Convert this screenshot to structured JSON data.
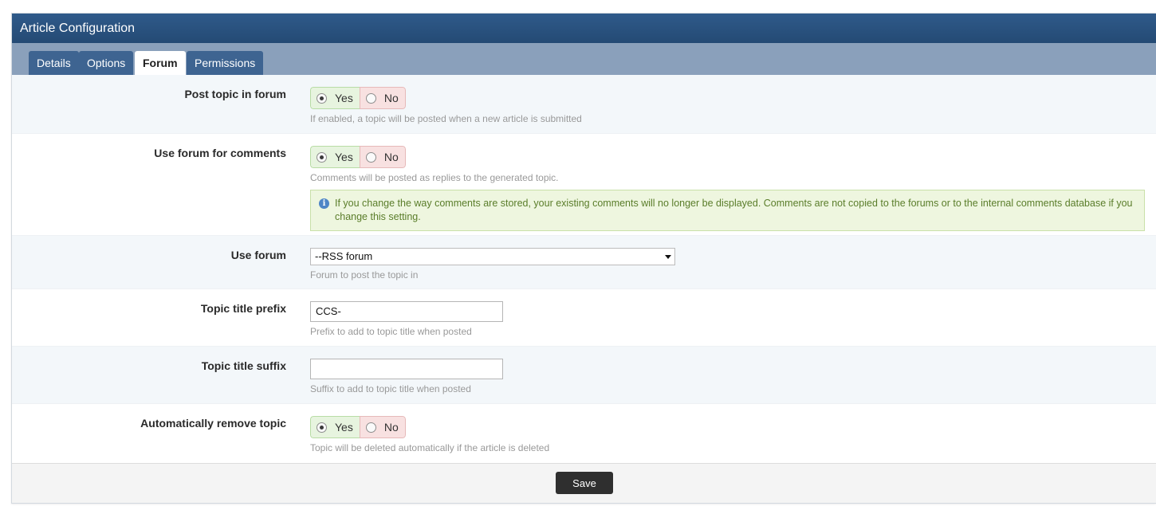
{
  "window": {
    "title": "Article Configuration"
  },
  "tabs": [
    {
      "label": "Details",
      "active": false
    },
    {
      "label": "Options",
      "active": false
    },
    {
      "label": "Forum",
      "active": true
    },
    {
      "label": "Permissions",
      "active": false
    }
  ],
  "fields": {
    "post_topic": {
      "label": "Post topic in forum",
      "selected": "Yes",
      "yes_label": "Yes",
      "no_label": "No",
      "hint": "If enabled, a topic will be posted when a new article is submitted"
    },
    "use_forum_comments": {
      "label": "Use forum for comments",
      "selected": "Yes",
      "yes_label": "Yes",
      "no_label": "No",
      "hint": "Comments will be posted as replies to the generated topic.",
      "notice": "If you change the way comments are stored, your existing comments will no longer be displayed. Comments are not copied to the forums or to the internal comments database if you change this setting."
    },
    "use_forum": {
      "label": "Use forum",
      "value": "--RSS forum",
      "hint": "Forum to post the topic in"
    },
    "topic_prefix": {
      "label": "Topic title prefix",
      "value": "CCS-",
      "hint": "Prefix to add to topic title when posted"
    },
    "topic_suffix": {
      "label": "Topic title suffix",
      "value": "",
      "hint": "Suffix to add to topic title when posted"
    },
    "auto_remove": {
      "label": "Automatically remove topic",
      "selected": "Yes",
      "yes_label": "Yes",
      "no_label": "No",
      "hint": "Topic will be deleted automatically if the article is deleted"
    }
  },
  "footer": {
    "save_label": "Save"
  },
  "colors": {
    "titlebar": "#2f5a8a",
    "tabbar": "#8aa0bb",
    "tab": "#3e6491",
    "yes_bg": "#e7f4df",
    "no_bg": "#f8e1e1",
    "notice_bg": "#eef6df",
    "notice_text": "#5a7d2a"
  }
}
